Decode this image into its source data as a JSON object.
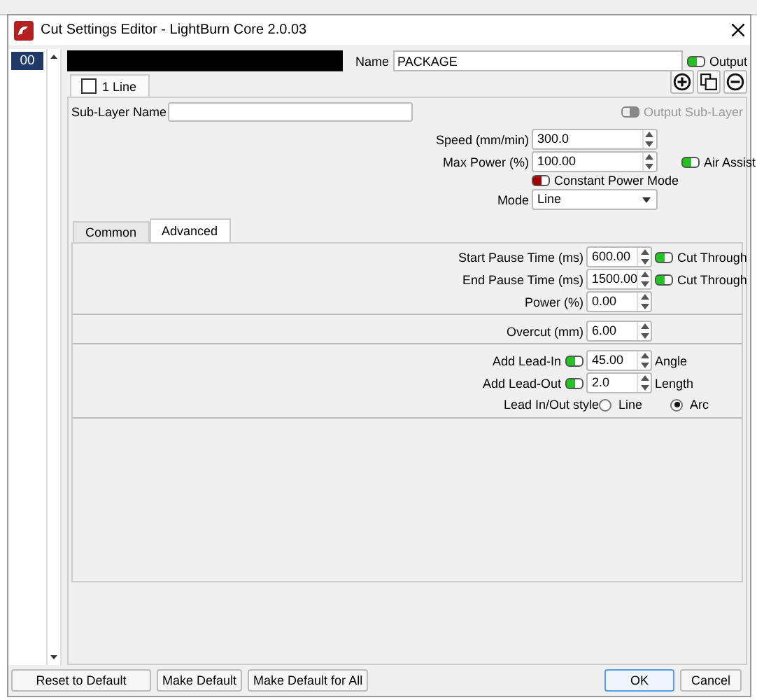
{
  "window": {
    "title": "Cut Settings Editor - LightBurn Core 2.0.03"
  },
  "layers": [
    {
      "label": "00",
      "selected": true
    }
  ],
  "name": {
    "label": "Name",
    "value": "PACKAGE"
  },
  "output": {
    "label": "Output",
    "on": true
  },
  "sublayer_tabs": [
    {
      "label": "1 Line",
      "selected": true
    }
  ],
  "sublayer_name": {
    "label": "Sub-Layer Name"
  },
  "output_sublayer": {
    "label": "Output Sub-Layer",
    "on": false,
    "disabled": true
  },
  "speed": {
    "label": "Speed (mm/min)",
    "value": "300.0"
  },
  "max_power": {
    "label": "Max Power (%)",
    "value": "100.00"
  },
  "air_assist": {
    "label": "Air Assist",
    "on": true
  },
  "constant_power": {
    "label": "Constant Power Mode",
    "on": false
  },
  "mode": {
    "label": "Mode",
    "value": "Line"
  },
  "tabs": [
    {
      "label": "Common",
      "selected": false
    },
    {
      "label": "Advanced",
      "selected": true
    }
  ],
  "advanced": [
    {
      "rows": [
        {
          "kind": "spin",
          "label": "Start Pause Time (ms)",
          "value": "600.00",
          "toggle": {
            "label": "Cut Through",
            "on": true
          }
        },
        {
          "kind": "spin",
          "label": "End Pause Time (ms)",
          "value": "1500.00",
          "toggle": {
            "label": "Cut Through",
            "on": true
          }
        },
        {
          "kind": "spin",
          "label": "Power (%)",
          "value": "0.00"
        }
      ]
    },
    {
      "rows": [
        {
          "kind": "spin",
          "label": "Overcut (mm)",
          "value": "6.00"
        }
      ]
    },
    {
      "rows": [
        {
          "kind": "spin",
          "label": "Add Lead-In",
          "lead_toggle": {
            "on": true
          },
          "value": "45.00",
          "suffix": "Angle"
        },
        {
          "kind": "spin",
          "label": "Add Lead-Out",
          "lead_toggle": {
            "on": true
          },
          "value": "2.0",
          "suffix": "Length"
        },
        {
          "kind": "radio",
          "label": "Lead In/Out style",
          "options": [
            {
              "label": "Line",
              "selected": false
            },
            {
              "label": "Arc",
              "selected": true
            }
          ]
        }
      ]
    }
  ],
  "buttons_left": [
    {
      "label": "Reset to Default"
    },
    {
      "label": "Make Default"
    },
    {
      "label": "Make Default for All"
    }
  ],
  "buttons_right": [
    {
      "label": "OK",
      "default": true
    },
    {
      "label": "Cancel",
      "default": false
    }
  ]
}
